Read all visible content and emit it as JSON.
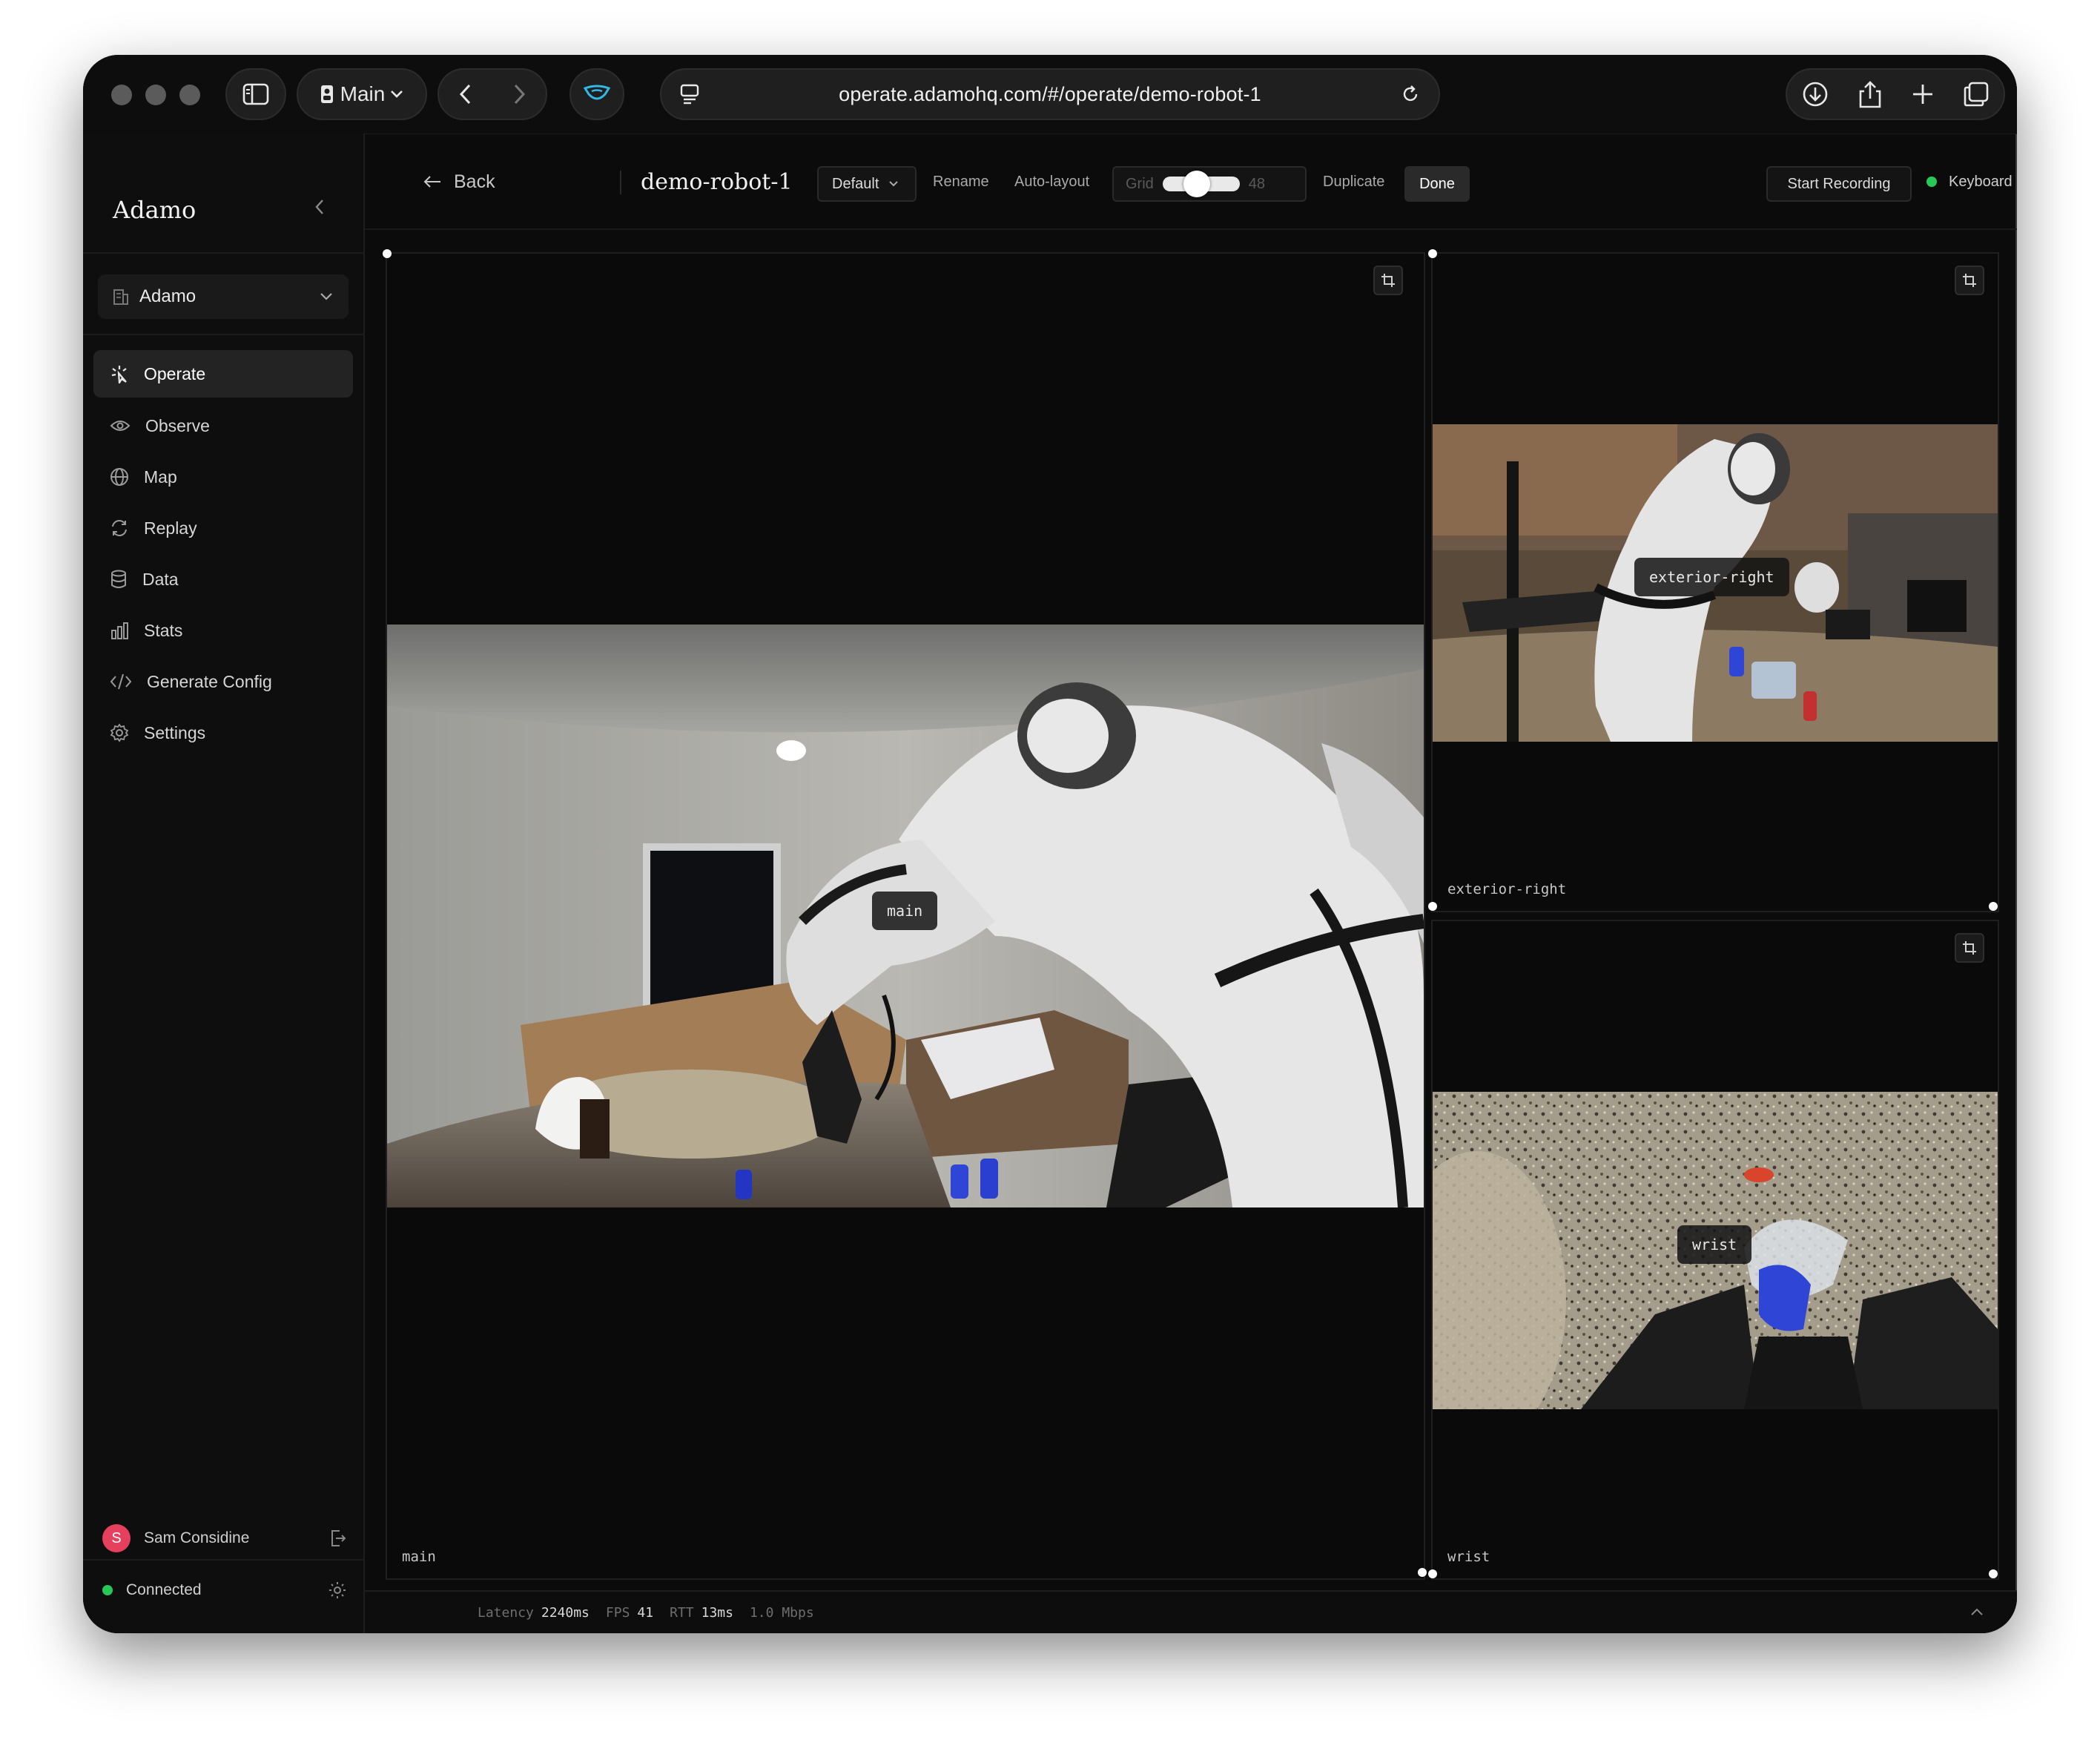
{
  "browser": {
    "tab_group_label": "Main",
    "url": "operate.adamohq.com/#/operate/demo-robot-1"
  },
  "sidebar": {
    "brand": "Adamo",
    "org": "Adamo",
    "items": [
      {
        "label": "Operate",
        "icon": "sparkle-icon",
        "active": true
      },
      {
        "label": "Observe",
        "icon": "eye-icon"
      },
      {
        "label": "Map",
        "icon": "globe-icon"
      },
      {
        "label": "Replay",
        "icon": "refresh-icon"
      },
      {
        "label": "Data",
        "icon": "database-icon"
      },
      {
        "label": "Stats",
        "icon": "bar-chart-icon"
      },
      {
        "label": "Generate Config",
        "icon": "code-icon"
      },
      {
        "label": "Settings",
        "icon": "gear-icon"
      }
    ],
    "user": {
      "initial": "S",
      "name": "Sam Considine"
    },
    "connection": "Connected"
  },
  "toolbar": {
    "back": "Back",
    "robot_name": "demo-robot-1",
    "layout_select": "Default",
    "rename": "Rename",
    "auto_layout": "Auto-layout",
    "grid_label": "Grid",
    "grid_value": "48",
    "duplicate": "Duplicate",
    "done": "Done",
    "start_recording": "Start Recording",
    "keyboard": "Keyboard"
  },
  "feeds": {
    "main": {
      "overlay": "main",
      "corner": "main"
    },
    "exterior_right": {
      "overlay": "exterior-right",
      "corner": "exterior-right"
    },
    "wrist": {
      "overlay": "wrist",
      "corner": "wrist"
    }
  },
  "status": {
    "latency_label": "Latency",
    "latency_value": "2240ms",
    "fps_label": "FPS",
    "fps_value": "41",
    "rtt_label": "RTT",
    "rtt_value": "13ms",
    "bitrate": "1.0 Mbps"
  },
  "colors": {
    "accent_green": "#26c957",
    "avatar": "#e5405e",
    "background": "#0b0b0b"
  }
}
